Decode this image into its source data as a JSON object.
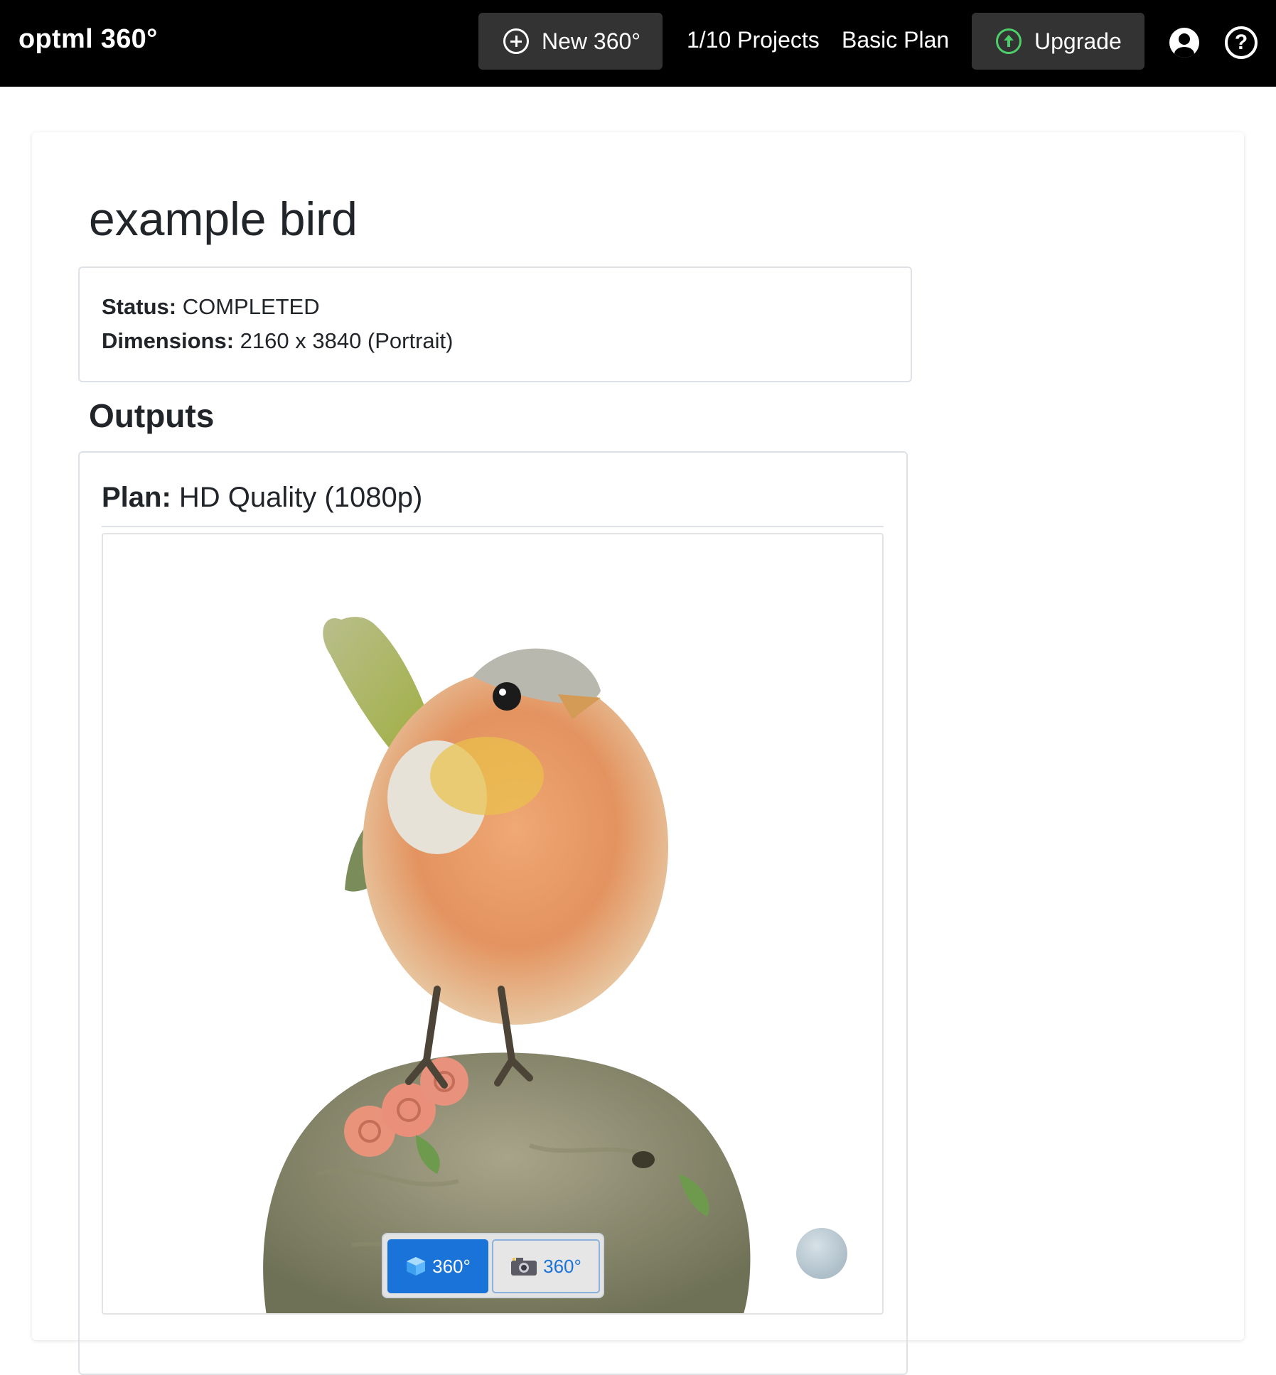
{
  "nav": {
    "brand": "optml 360°",
    "new_button": "New 360°",
    "projects": "1/10 Projects",
    "plan": "Basic Plan",
    "upgrade_button": "Upgrade"
  },
  "project": {
    "title": "example bird",
    "status_label": "Status:",
    "status_value": "COMPLETED",
    "dimensions_label": "Dimensions:",
    "dimensions_value": "2160 x 3840 (Portrait)"
  },
  "outputs": {
    "heading": "Outputs",
    "plan_label": "Plan:",
    "plan_value": "HD Quality (1080p)",
    "viewer_toggle": [
      {
        "label": "360°",
        "icon": "cube-icon",
        "active": true
      },
      {
        "label": "360°",
        "icon": "camera-icon",
        "active": false
      }
    ]
  },
  "colors": {
    "nav_bg": "#000000",
    "nav_button_bg": "#333333",
    "upgrade_accent": "#4ccf6a",
    "toggle_active": "#1a73d8"
  }
}
